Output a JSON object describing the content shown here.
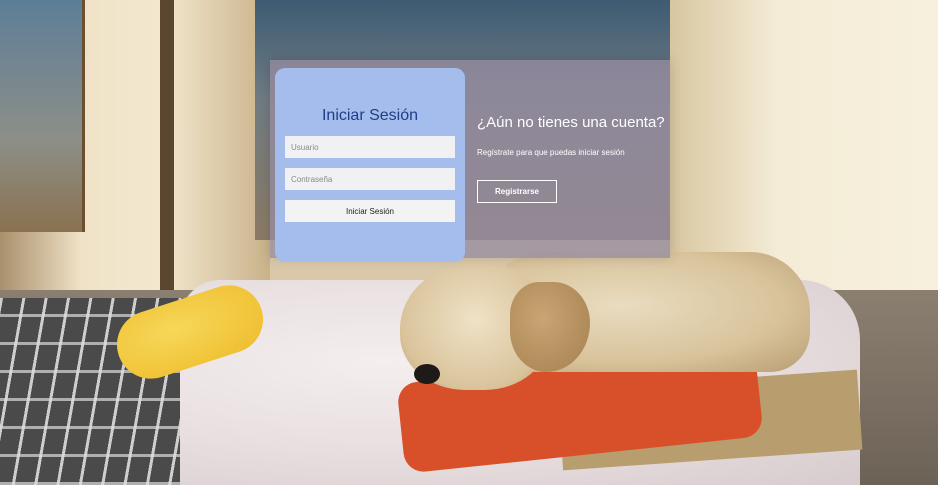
{
  "login": {
    "title": "Iniciar Sesión",
    "username_placeholder": "Usuario",
    "password_placeholder": "Contraseña",
    "submit_label": "Iniciar Sesión"
  },
  "signup": {
    "title": "¿Aún no tienes una cuenta?",
    "subtitle": "Regístrate para que puedas iniciar sesión",
    "button_label": "Registrarse"
  },
  "colors": {
    "login_card": "#a4bdec",
    "login_title": "#1e3f86",
    "overlay_panel": "#968ca0",
    "text_light": "#ffffff"
  },
  "background": {
    "icon": "puppy-photo"
  }
}
